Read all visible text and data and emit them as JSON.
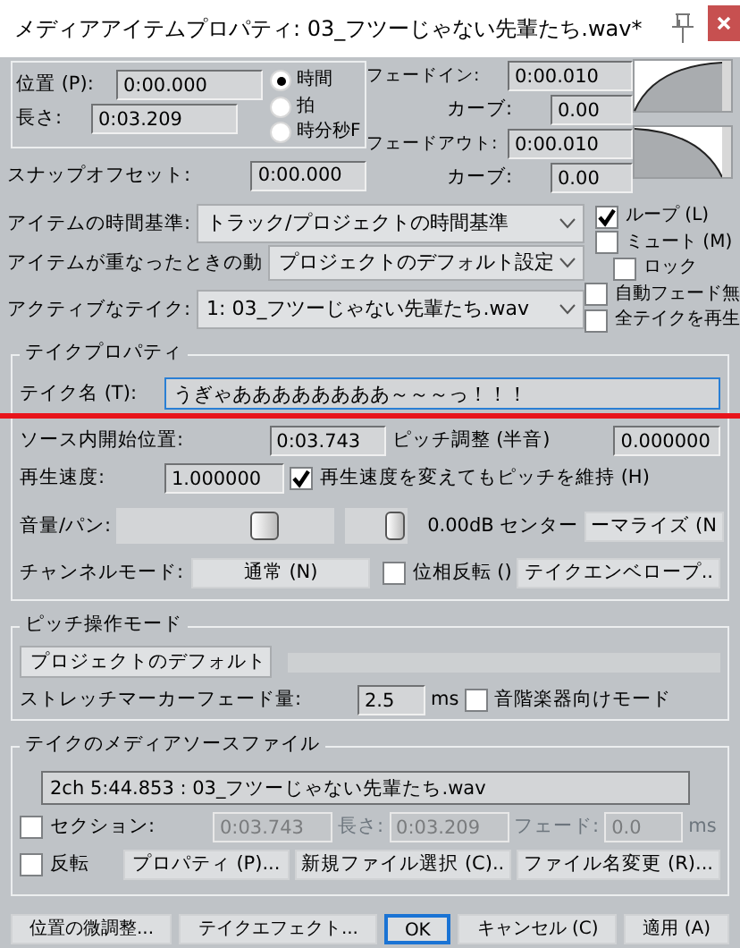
{
  "window": {
    "title": "メディアアイテムプロパティ: 03_フツーじゃない先輩たち.wav*"
  },
  "position_group": {
    "position_label": "位置 (P):",
    "position": "0:00.000",
    "length_label": "長さ:",
    "length": "0:03.209",
    "time_units": [
      {
        "label": "時間",
        "selected": true
      },
      {
        "label": "拍",
        "selected": false
      },
      {
        "label": "時分秒F",
        "selected": false
      }
    ]
  },
  "fade_in": {
    "label": "フェードイン:",
    "value": "0:00.010",
    "curve_label": "カーブ:",
    "curve": "0.00"
  },
  "fade_out": {
    "label": "フェードアウト:",
    "value": "0:00.010",
    "curve_label": "カーブ:",
    "curve": "0.00"
  },
  "snap_offset": {
    "label": "スナップオフセット:",
    "value": "0:00.000"
  },
  "item_timebase": {
    "label": "アイテムの時間基準:",
    "value": "トラック/プロジェクトの時間基準"
  },
  "overlap": {
    "label": "アイテムが重なったときの動",
    "value": "プロジェクトのデフォルト設定"
  },
  "active_take": {
    "label": "アクティブなテイク:",
    "value": "1: 03_フツーじゃない先輩たち.wav"
  },
  "options": [
    {
      "label": "ループ (L)",
      "checked": true
    },
    {
      "label": "ミュート (M)",
      "checked": false
    },
    {
      "label": "ロック",
      "checked": false
    },
    {
      "label": "自動フェード無",
      "checked": false
    },
    {
      "label": "全テイクを再生",
      "checked": false
    }
  ],
  "take_properties": {
    "title": "テイクプロパティ",
    "name_label": "テイク名 (T):",
    "name": "うぎゃああああああああ～～～っ！！！",
    "start_label": "ソース内開始位置:",
    "start": "0:03.743",
    "pitch_label": "ピッチ調整 (半音)",
    "pitch": "0.000000",
    "rate_label": "再生速度:",
    "rate": "1.000000",
    "preserve_pitch": {
      "label": "再生速度を変えてもピッチを維持 (H)",
      "checked": true
    },
    "volpan_label": "音量/パン:",
    "volume": {
      "level": 0.68
    },
    "pan": {
      "level": 0.8
    },
    "volpan_reading": "0.00dB センター",
    "normalize_button": "ーマライズ (N",
    "channel_label": "チャンネルモード:",
    "channel_mode": "通常 (N)",
    "invert_phase": {
      "label": "位相反転 ()",
      "checked": false
    },
    "envelope_button": "テイクエンベロープ.."
  },
  "pitch_mode": {
    "title": "ピッチ操作モード",
    "mode": "プロジェクトのデフォルト",
    "stretch_label": "ストレッチマーカーフェード量:",
    "stretch": "2.5",
    "stretch_unit": "ms",
    "tonal": {
      "label": "音階楽器向けモード",
      "checked": false
    }
  },
  "source": {
    "title": "テイクのメディアソースファイル",
    "file": "2ch 5:44.853 : 03_フツーじゃない先輩たち.wav",
    "section": {
      "label": "セクション:",
      "checked": false
    },
    "section_fields_disabled": true,
    "section_start": "0:03.743",
    "length_label": "長さ:",
    "section_length": "0:03.209",
    "fade_label": "フェード:",
    "fade": "0.0",
    "fade_unit": "ms",
    "reverse": {
      "label": "反転",
      "checked": false
    },
    "buttons": [
      "プロパティ (P)...",
      "新規ファイル選択 (C)..",
      "ファイル名変更 (R)..."
    ]
  },
  "footer_buttons": [
    {
      "label": "位置の微調整...",
      "default": false
    },
    {
      "label": "テイクエフェクト...",
      "default": false
    },
    {
      "label": "OK",
      "default": true
    },
    {
      "label": "キャンセル (C)",
      "default": false
    },
    {
      "label": "適用 (A)",
      "default": false
    }
  ]
}
